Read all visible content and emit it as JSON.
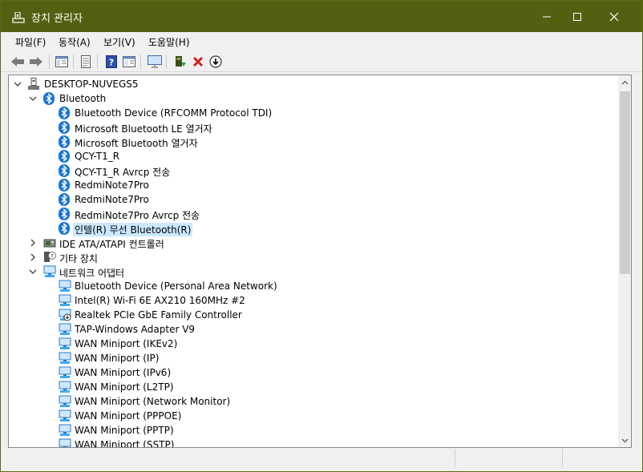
{
  "window": {
    "title": "장치 관리자",
    "min_glyph": "—",
    "max_glyph": "☐",
    "close_glyph": "✕",
    "titlebar_color": "#545f12"
  },
  "menu": {
    "items": [
      "파일(F)",
      "동작(A)",
      "보기(V)",
      "도움말(H)"
    ]
  },
  "toolbar": {
    "buttons": [
      {
        "name": "back-icon",
        "glyph": "⬅"
      },
      {
        "name": "forward-icon",
        "glyph": "➡"
      },
      {
        "name": "show-hide-console-tree-icon",
        "glyph": ""
      },
      {
        "name": "properties-icon",
        "glyph": ""
      },
      {
        "name": "help-icon",
        "glyph": "?"
      },
      {
        "name": "scan-hardware-changes-icon",
        "glyph": ""
      },
      {
        "name": "display-icon",
        "glyph": ""
      },
      {
        "name": "update-driver-icon",
        "glyph": ""
      },
      {
        "name": "uninstall-device-icon",
        "glyph": "✖"
      },
      {
        "name": "disable-device-icon",
        "glyph": "⬇"
      }
    ]
  },
  "tree": {
    "root": "DESKTOP-NUVEGS5",
    "bluetooth_category": "Bluetooth",
    "bluetooth_devices": [
      "Bluetooth Device (RFCOMM Protocol TDI)",
      "Microsoft Bluetooth LE 열거자",
      "Microsoft Bluetooth 열거자",
      "QCY-T1_R",
      "QCY-T1_R Avrcp 전송",
      "RedmiNote7Pro",
      "RedmiNote7Pro",
      "RedmiNote7Pro Avrcp 전송",
      "인텔(R) 무선 Bluetooth(R)"
    ],
    "ide_category": "IDE ATA/ATAPI 컨트롤러",
    "other_category": "기타 장치",
    "network_category": "네트워크 어댑터",
    "network_devices": [
      "Bluetooth Device (Personal Area Network)",
      "Intel(R) Wi-Fi 6E AX210 160MHz #2",
      "Realtek PCIe GbE Family Controller",
      "TAP-Windows Adapter V9",
      "WAN Miniport (IKEv2)",
      "WAN Miniport (IP)",
      "WAN Miniport (IPv6)",
      "WAN Miniport (L2TP)",
      "WAN Miniport (Network Monitor)",
      "WAN Miniport (PPPOE)",
      "WAN Miniport (PPTP)",
      "WAN Miniport (SSTP)"
    ],
    "selected_index": 8,
    "selection_color": "#cce8ff",
    "bluetooth_color": "#1976d2"
  },
  "scrollbar": {
    "up": "▲",
    "down": "▼"
  }
}
